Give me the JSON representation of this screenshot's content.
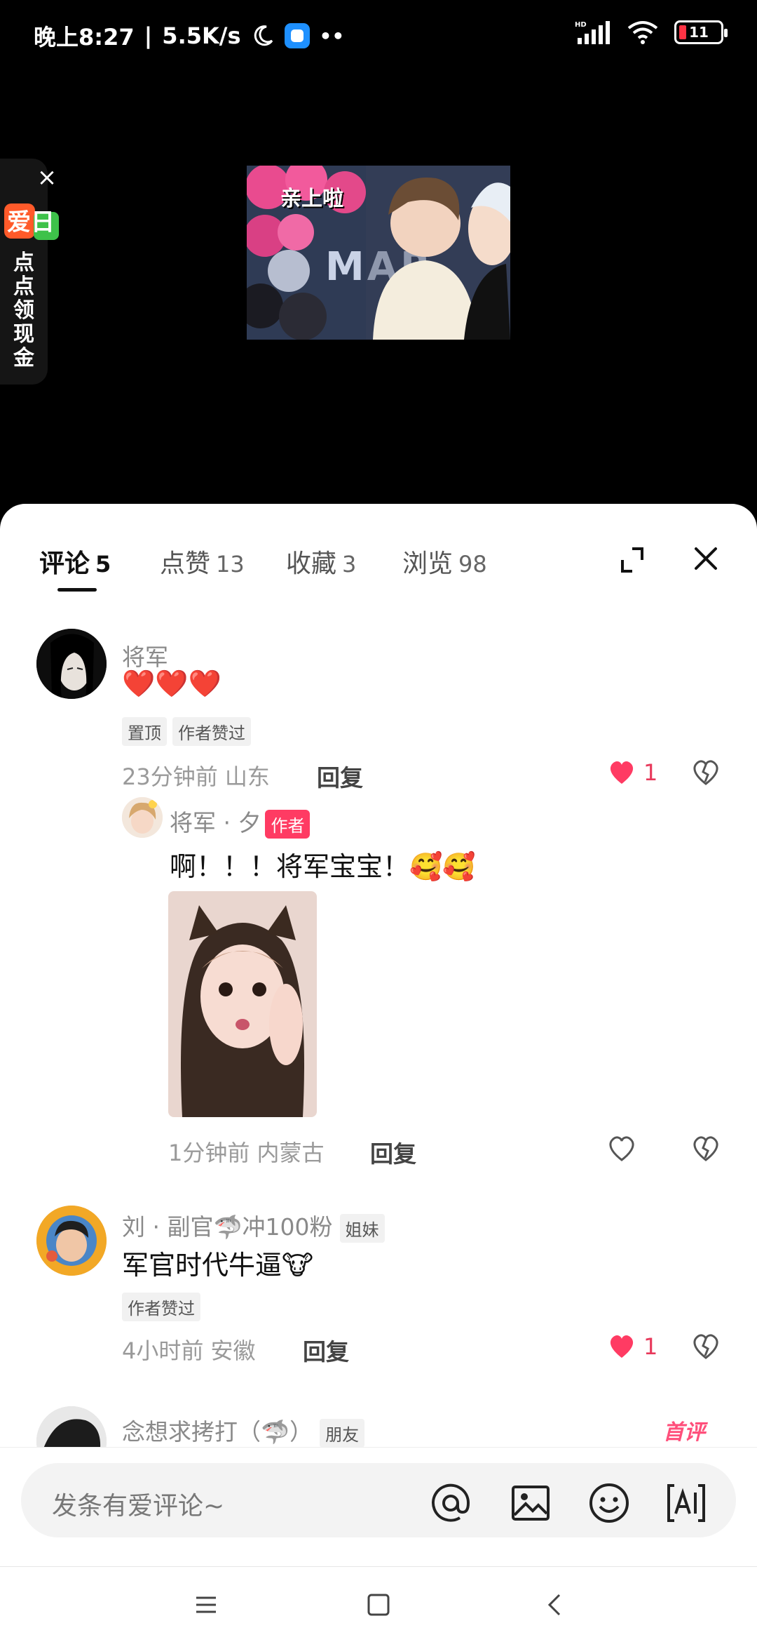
{
  "status_bar": {
    "time": "晚上8:27",
    "speed": "5.5K/s",
    "battery": "11"
  },
  "video": {
    "caption": "亲上啦",
    "sign_text": "MAR"
  },
  "cash_widget": {
    "logo_text": "爱日",
    "text": "点点领现金"
  },
  "tabs": [
    {
      "label": "评论",
      "count": "5"
    },
    {
      "label": "点赞",
      "count": "13"
    },
    {
      "label": "收藏",
      "count": "3"
    },
    {
      "label": "浏览",
      "count": "98"
    }
  ],
  "comments": [
    {
      "name": "将军",
      "body": "❤️❤️❤️",
      "tags": [
        "置顶",
        "作者赞过"
      ],
      "time": "23分钟前",
      "location": "山东",
      "reply": "回复",
      "likes": "1"
    },
    {
      "name": "将军 · 夕",
      "badge": "作者",
      "body": "啊！！！将军宝宝！🥰🥰",
      "time": "1分钟前",
      "location": "内蒙古",
      "reply": "回复"
    },
    {
      "name": "刘 · 副官🦈冲100粉",
      "badge": "姐妹",
      "body": "军官时代牛逼🐮",
      "tags": [
        "作者赞过"
      ],
      "time": "4小时前",
      "location": "安徽",
      "reply": "回复",
      "likes": "1"
    },
    {
      "name": "念想求拷打（🦈）",
      "badge": "朋友",
      "first": "首评"
    }
  ],
  "input": {
    "placeholder": "发条有爱评论~"
  },
  "colors": {
    "accent": "#ff3b63",
    "like": "#e8395b"
  }
}
